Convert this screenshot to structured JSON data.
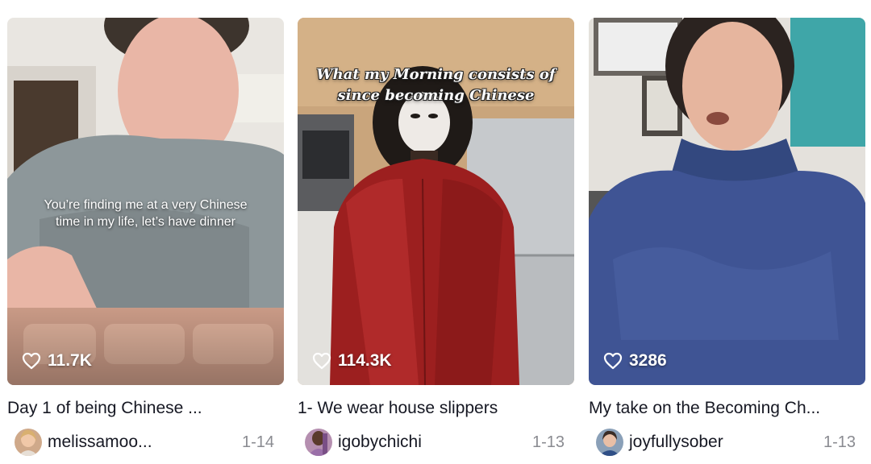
{
  "videos": [
    {
      "overlay_text": "You’re finding me at a very Chinese\ntime in my life, let’s have dinner",
      "likes": "11.7K",
      "title": "Day 1 of being Chinese ...",
      "username": "melissamoo...",
      "date": "1-14"
    },
    {
      "overlay_text": "What my Morning consists of\nsince becoming Chinese",
      "likes": "114.3K",
      "title": "1- We wear house slippers",
      "username": "igobychichi",
      "date": "1-13"
    },
    {
      "overlay_text": "",
      "likes": "3286",
      "title": "My take on the Becoming Ch...",
      "username": "joyfullysober",
      "date": "1-13"
    }
  ],
  "icons": {
    "like": "heart-outline-icon"
  },
  "colors": {
    "text_primary": "#161823",
    "text_secondary": "#8a8b91",
    "overlay_text": "#ffffff"
  }
}
